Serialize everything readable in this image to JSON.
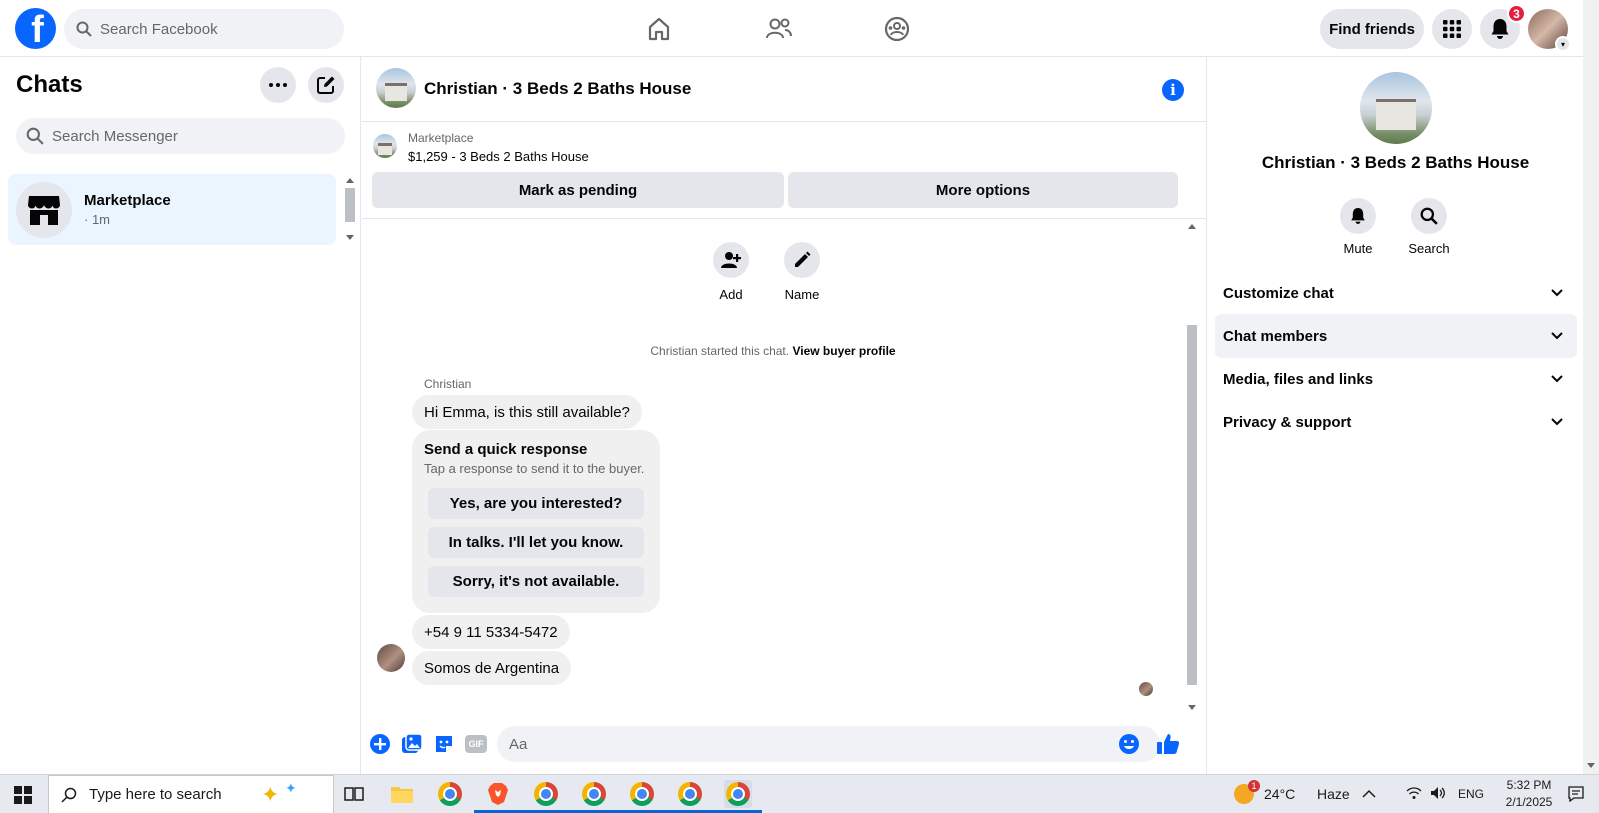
{
  "topbar": {
    "logo_letter": "f",
    "search_placeholder": "Search Facebook",
    "find_friends_label": "Find friends",
    "notification_count": "3"
  },
  "sidebar": {
    "title": "Chats",
    "search_placeholder": "Search Messenger",
    "chats": [
      {
        "name": "Marketplace",
        "subtitle": "· 1m"
      }
    ]
  },
  "conversation": {
    "title": "Christian · 3 Beds 2 Baths House",
    "marketplace_label": "Marketplace",
    "listing": "$1,259 - 3 Beds 2 Baths House",
    "mark_pending_label": "Mark as pending",
    "more_options_label": "More options",
    "actions": [
      {
        "label": "Add",
        "icon": "add-person-icon"
      },
      {
        "label": "Name",
        "icon": "pencil-icon"
      }
    ],
    "started_text": "Christian started this chat.",
    "view_profile_label": "View buyer profile",
    "sender": "Christian",
    "messages": {
      "first": "Hi Emma, is this still available?",
      "phone": "+54 9 11 5334-5472",
      "last": "Somos de Argentina"
    },
    "quick_response": {
      "title": "Send a quick response",
      "subtitle": "Tap a response to send it to the buyer.",
      "options": [
        "Yes, are you interested?",
        "In talks. I'll let you know.",
        "Sorry, it's not available."
      ]
    },
    "composer_placeholder": "Aa",
    "composer_icons": [
      "plus-icon",
      "photo-icon",
      "sticker-icon",
      "gif-icon",
      "emoji-icon",
      "like-icon"
    ],
    "gif_label": "GIF"
  },
  "right_panel": {
    "title": "Christian · 3 Beds 2 Baths House",
    "actions": [
      {
        "label": "Mute",
        "icon": "bell-icon"
      },
      {
        "label": "Search",
        "icon": "search-icon"
      }
    ],
    "sections": [
      "Customize chat",
      "Chat members",
      "Media, files and links",
      "Privacy & support"
    ],
    "highlighted_section": "Chat members"
  },
  "taskbar": {
    "search_placeholder": "Type here to search",
    "weather_temp": "24°C",
    "weather_desc": "Haze",
    "weather_badge": "1",
    "language": "ENG",
    "time": "5:32 PM",
    "date": "2/1/2025"
  },
  "colors": {
    "brand": "#0866ff",
    "badge": "#e41e3f",
    "selected_chat": "#ebf5ff",
    "bubble": "#f0f0f0"
  }
}
